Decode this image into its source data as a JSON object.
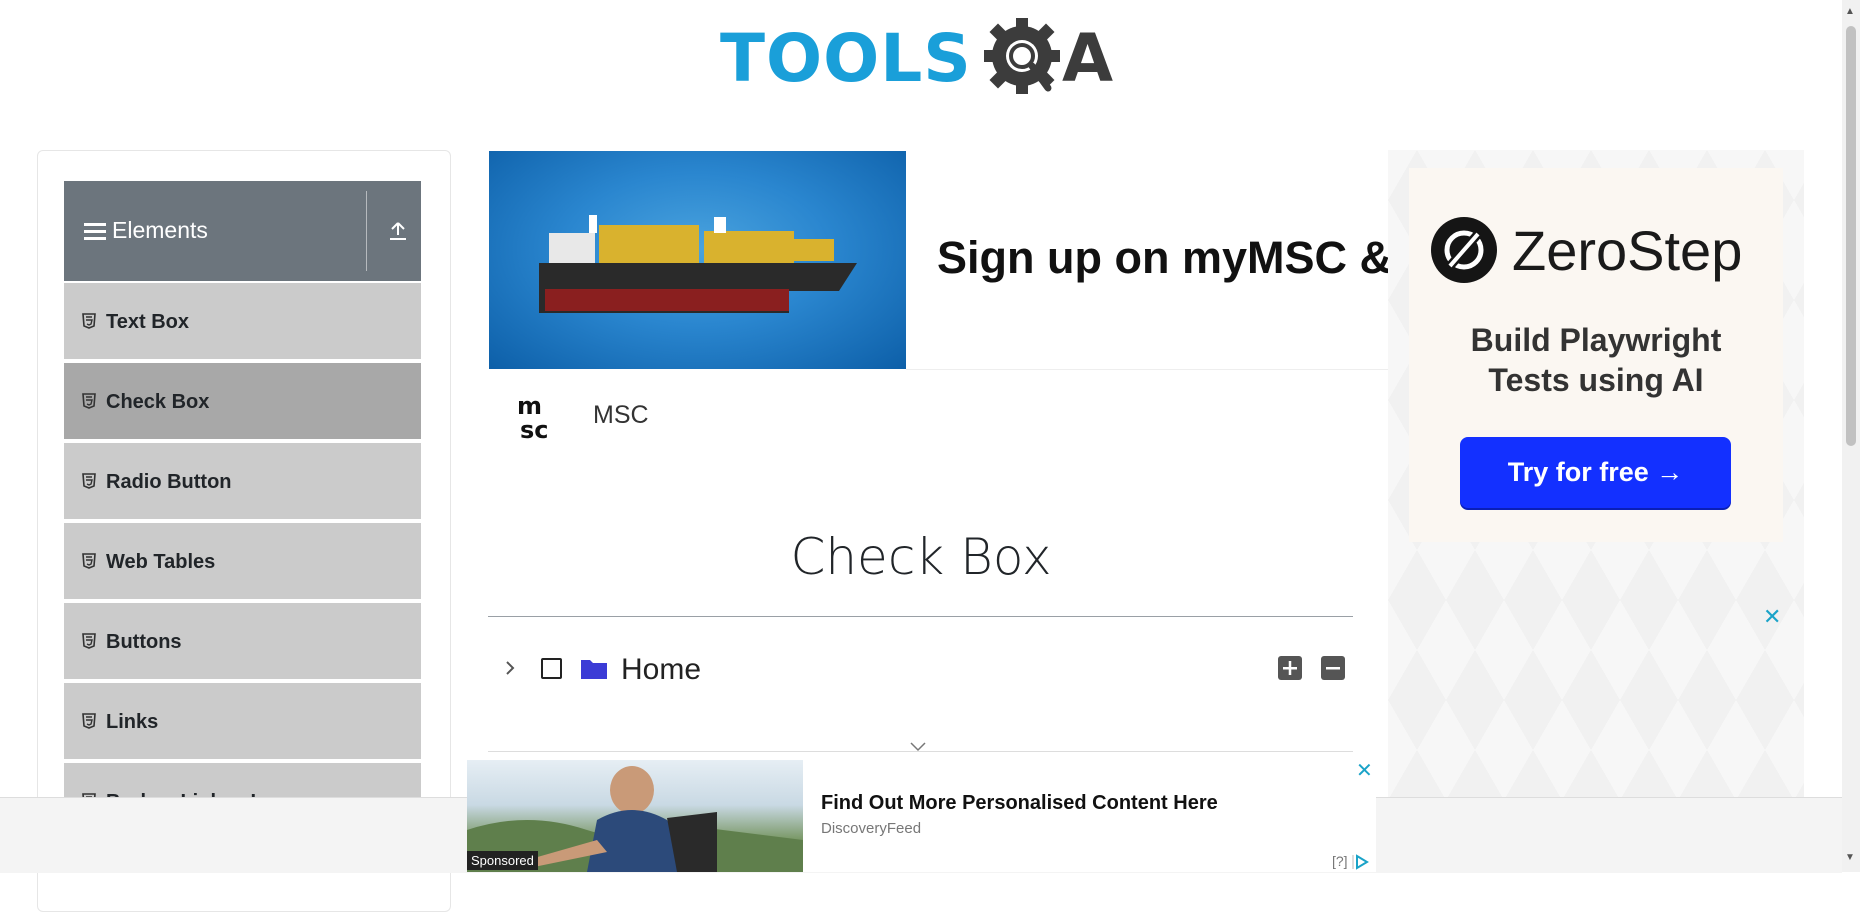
{
  "header": {
    "logo_text_part1": "TOOLS",
    "logo_text_part2": "A"
  },
  "sidebar": {
    "group_title": "Elements",
    "items": [
      {
        "label": "Text Box"
      },
      {
        "label": "Check Box"
      },
      {
        "label": "Radio Button"
      },
      {
        "label": "Web Tables"
      },
      {
        "label": "Buttons"
      },
      {
        "label": "Links"
      },
      {
        "label": "Broken Links - Images"
      }
    ]
  },
  "top_ad": {
    "headline": "Sign up on myMSC & B",
    "advertiser": "MSC"
  },
  "main": {
    "title": "Check Box",
    "tree": {
      "root_label": "Home",
      "expanded": false,
      "checked": false
    }
  },
  "right_ad": {
    "brand": "ZeroStep",
    "tagline_line1": "Build Playwright",
    "tagline_line2": "Tests using AI",
    "cta": "Try for free →",
    "close": "✕"
  },
  "bottom_ad": {
    "sponsored_label": "Sponsored",
    "headline": "Find Out More Personalised Content Here",
    "source": "DiscoveryFeed",
    "close": "✕",
    "adchoices": "[?]"
  },
  "colors": {
    "brand_blue": "#1a9fd9",
    "sidebar_header": "#6c757d",
    "sidebar_item": "#cbcbcb",
    "sidebar_item_active": "#a8a8a8",
    "folder_icon": "#3b3bd6",
    "cta_blue": "#1330ff"
  }
}
